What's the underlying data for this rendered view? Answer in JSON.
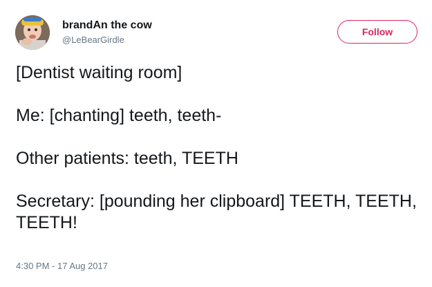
{
  "user": {
    "display_name": "brandAn the cow",
    "handle": "@LeBearGirdle"
  },
  "follow_button": {
    "label": "Follow"
  },
  "tweet": {
    "lines": [
      "[Dentist waiting room]",
      "Me: [chanting] teeth, teeth-",
      "Other patients: teeth, TEETH",
      "Secretary: [pounding her clipboard] TEETH, TEETH, TEETH!"
    ],
    "timestamp": "4:30 PM - 17 Aug 2017"
  },
  "colors": {
    "follow_accent": "#e0245e",
    "secondary_text": "#657786",
    "primary_text": "#14171a"
  }
}
